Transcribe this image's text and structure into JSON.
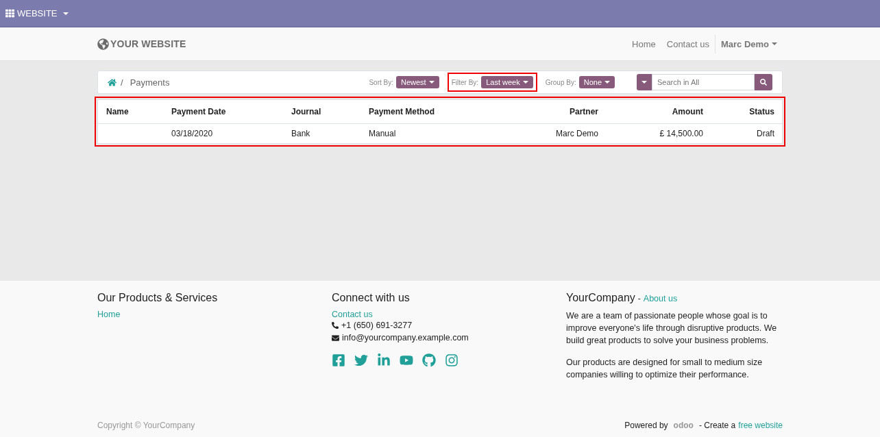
{
  "admin_bar": {
    "menu": "WEBSITE"
  },
  "header": {
    "logo": "YOUR WEBSITE",
    "nav": [
      {
        "label": "Home"
      },
      {
        "label": "Contact us"
      }
    ],
    "user": "Marc Demo"
  },
  "breadcrumb": {
    "current": "Payments",
    "separator": "/"
  },
  "controls": [
    {
      "label": "Sort By:",
      "value": "Newest",
      "highlighted": false
    },
    {
      "label": "Filter By:",
      "value": "Last week",
      "highlighted": true
    },
    {
      "label": "Group By:",
      "value": "None",
      "highlighted": false
    }
  ],
  "search": {
    "placeholder": "Search in All"
  },
  "table": {
    "highlighted": true,
    "columns": [
      "Name",
      "Payment Date",
      "Journal",
      "Payment Method",
      "Partner",
      "Amount",
      "Status"
    ],
    "rows": [
      [
        "",
        "03/18/2020",
        "Bank",
        "Manual",
        "Marc Demo",
        "£ 14,500.00",
        "Draft"
      ]
    ]
  },
  "footer": {
    "products": {
      "title": "Our Products & Services",
      "links": [
        "Home"
      ]
    },
    "connect": {
      "title": "Connect with us",
      "link": "Contact us",
      "phone": "+1 (650) 691-3277",
      "email": "info@yourcompany.example.com"
    },
    "about": {
      "title": "YourCompany",
      "separator": "-",
      "link": "About us",
      "paragraphs": [
        "We are a team of passionate people whose goal is to improve everyone's life through disruptive products. We build great products to solve your business problems.",
        "Our products are designed for small to medium size companies willing to optimize their performance."
      ]
    },
    "copyright": "Copyright © YourCompany",
    "powered": "Powered by",
    "brand": "odoo",
    "create": "- Create a",
    "create_link": "free website"
  }
}
